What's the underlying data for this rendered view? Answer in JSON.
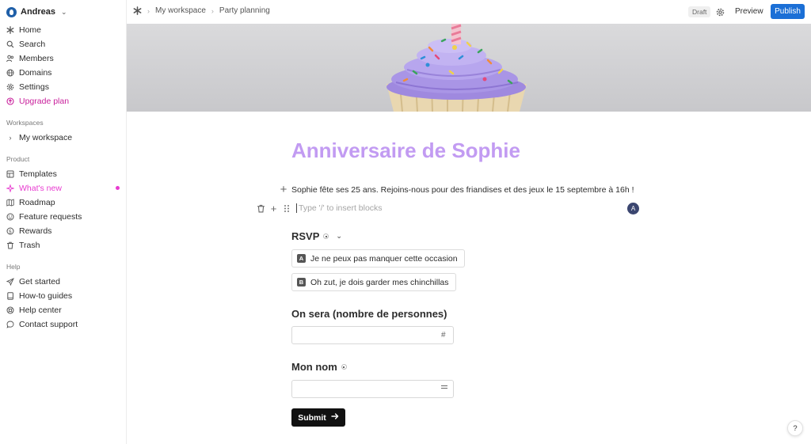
{
  "account": {
    "name": "Andreas"
  },
  "sidebar": {
    "main": [
      {
        "label": "Home",
        "icon": "home-icon"
      },
      {
        "label": "Search",
        "icon": "search-icon"
      },
      {
        "label": "Members",
        "icon": "members-icon"
      },
      {
        "label": "Domains",
        "icon": "globe-icon"
      },
      {
        "label": "Settings",
        "icon": "gear-icon"
      },
      {
        "label": "Upgrade plan",
        "icon": "upgrade-icon"
      }
    ],
    "workspaces_header": "Workspaces",
    "workspace_item": "My workspace",
    "product_header": "Product",
    "product": [
      {
        "label": "Templates",
        "icon": "templates-icon"
      },
      {
        "label": "What's new",
        "icon": "sparkle-icon"
      },
      {
        "label": "Roadmap",
        "icon": "map-icon"
      },
      {
        "label": "Feature requests",
        "icon": "feature-request-icon"
      },
      {
        "label": "Rewards",
        "icon": "rewards-icon"
      },
      {
        "label": "Trash",
        "icon": "trash-icon"
      }
    ],
    "help_header": "Help",
    "help": [
      {
        "label": "Get started",
        "icon": "send-icon"
      },
      {
        "label": "How-to guides",
        "icon": "book-icon"
      },
      {
        "label": "Help center",
        "icon": "lifebuoy-icon"
      },
      {
        "label": "Contact support",
        "icon": "chat-icon"
      }
    ]
  },
  "topbar": {
    "breadcrumbs": [
      "My workspace",
      "Party planning"
    ],
    "status_badge": "Draft",
    "preview_label": "Preview",
    "publish_label": "Publish"
  },
  "form": {
    "title": "Anniversaire de Sophie",
    "description": "Sophie fête ses 25 ans. Rejoins-nous pour des friandises et des jeux le 15 septembre à 16h !",
    "insert_placeholder": "Type '/' to insert blocks",
    "collaborator_initial": "A",
    "questions": {
      "rsvp": {
        "label": "RSVP",
        "options": [
          {
            "key": "A",
            "label": "Je ne peux pas manquer cette occasion"
          },
          {
            "key": "B",
            "label": "Oh zut, je dois garder mes chinchillas"
          }
        ]
      },
      "guests": {
        "label": "On sera (nombre de personnes)",
        "value": "",
        "icon": "hash-icon"
      },
      "name": {
        "label": "Mon nom",
        "value": "",
        "icon": "short-text-icon"
      }
    },
    "submit_label": "Submit",
    "help_label": "?"
  },
  "colors": {
    "title": "#c29bf2",
    "accent": "#1b6fd6",
    "upgrade": "#c81f9b",
    "whats_new": "#e83bd0"
  }
}
